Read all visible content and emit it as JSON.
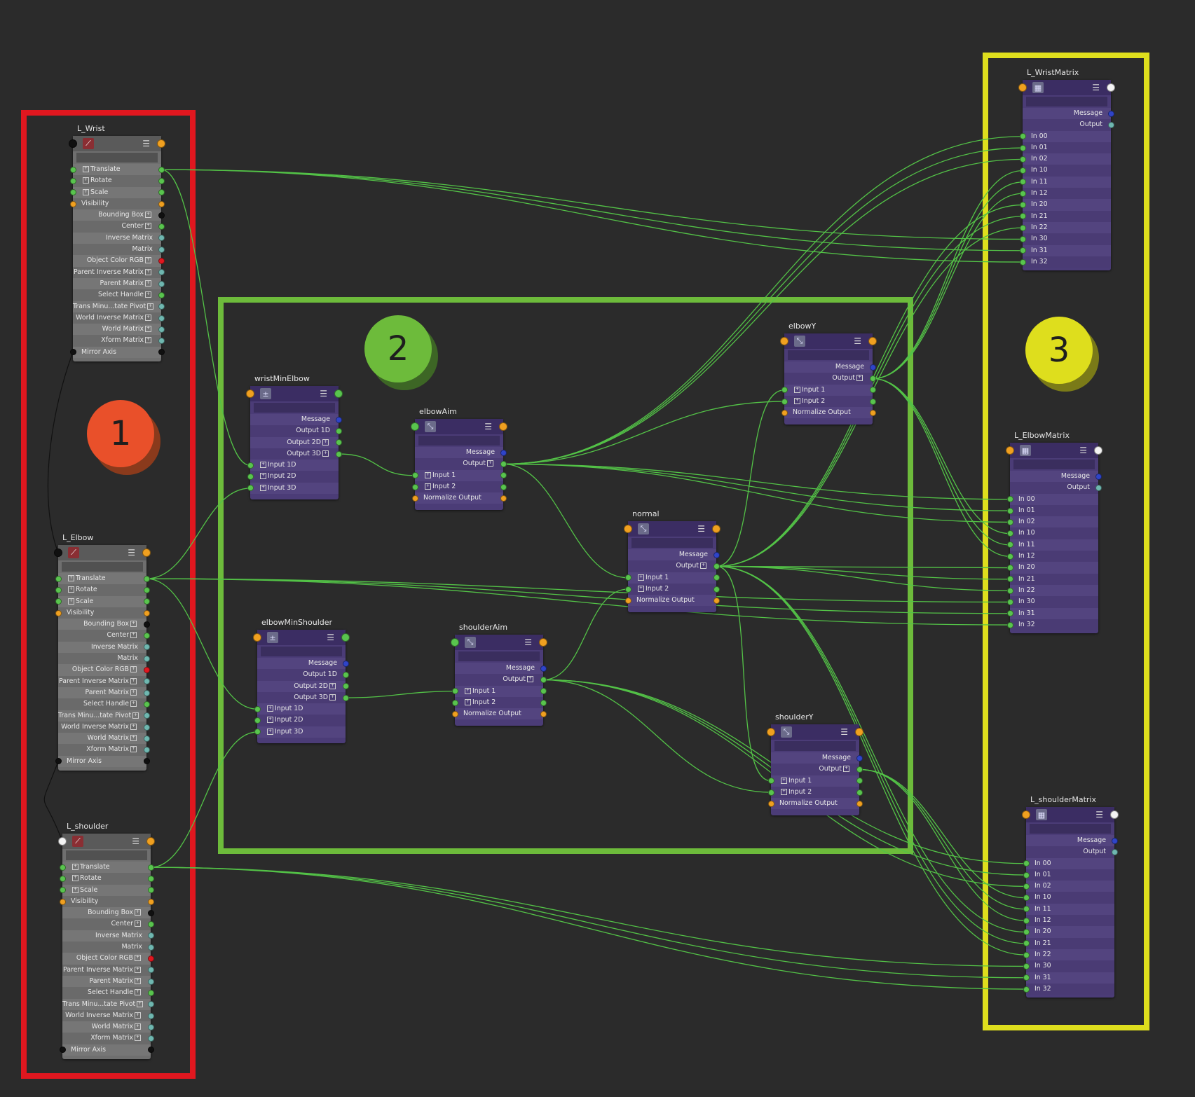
{
  "badges": [
    {
      "label": "1",
      "color": "#e9502a",
      "text_color": "#1e1e1e"
    },
    {
      "label": "2",
      "color": "#6dbb3b",
      "text_color": "#1e1e1e"
    },
    {
      "label": "3",
      "color": "#dede1d",
      "text_color": "#1e1e1e"
    }
  ],
  "frame_colors": {
    "joints": "#e0171f",
    "math": "#6dbb3b",
    "matrices": "#dede1d"
  },
  "port_colors": {
    "green": "#59c44e",
    "orange": "#f0a020",
    "blue": "#2f44c8",
    "teal": "#6fb7b0",
    "black": "#101010",
    "red": "#e0171f",
    "white": "#f4f4f4"
  },
  "wire_color": "#53c247",
  "joints": [
    {
      "name": "L_Wrist",
      "icon": "joint-icon"
    },
    {
      "name": "L_Elbow",
      "icon": "joint-icon"
    },
    {
      "name": "L_shoulder",
      "icon": "joint-icon"
    }
  ],
  "joint_attrs": [
    "Translate",
    "Rotate",
    "Scale",
    "Visibility",
    "Bounding Box",
    "Center",
    "Inverse Matrix",
    "Matrix",
    "Object Color RGB",
    "Parent Inverse Matrix",
    "Parent Matrix",
    "Select Handle",
    "Trans Minu...tate Pivot",
    "World Inverse Matrix",
    "World Matrix",
    "Xform Matrix",
    "Mirror Axis"
  ],
  "math_nodes": [
    {
      "name": "wristMinElbow",
      "icon": "plus-minus-average-icon",
      "rows": [
        "Message",
        "Output 1D",
        "Output 2D",
        "Output 3D",
        "Input 1D",
        "Input 2D",
        "Input 3D"
      ]
    },
    {
      "name": "elbowMinShoulder",
      "icon": "plus-minus-average-icon",
      "rows": [
        "Message",
        "Output 1D",
        "Output 2D",
        "Output 3D",
        "Input 1D",
        "Input 2D",
        "Input 3D"
      ]
    },
    {
      "name": "elbowAim",
      "icon": "vector-product-icon",
      "rows": [
        "Message",
        "Output",
        "Input 1",
        "Input 2",
        "Normalize Output"
      ]
    },
    {
      "name": "shoulderAim",
      "icon": "vector-product-icon",
      "rows": [
        "Message",
        "Output",
        "Input 1",
        "Input 2",
        "Normalize Output"
      ]
    },
    {
      "name": "normal",
      "icon": "vector-product-icon",
      "rows": [
        "Message",
        "Output",
        "Input 1",
        "Input 2",
        "Normalize Output"
      ]
    },
    {
      "name": "elbowY",
      "icon": "vector-product-icon",
      "rows": [
        "Message",
        "Output",
        "Input 1",
        "Input 2",
        "Normalize Output"
      ]
    },
    {
      "name": "shoulderY",
      "icon": "vector-product-icon",
      "rows": [
        "Message",
        "Output",
        "Input 1",
        "Input 2",
        "Normalize Output"
      ]
    }
  ],
  "matrix_nodes": [
    {
      "name": "L_WristMatrix",
      "icon": "four-by-four-matrix-icon"
    },
    {
      "name": "L_ElbowMatrix",
      "icon": "four-by-four-matrix-icon"
    },
    {
      "name": "L_shoulderMatrix",
      "icon": "four-by-four-matrix-icon"
    }
  ],
  "matrix_rows": [
    "Message",
    "Output",
    "In 00",
    "In 01",
    "In 02",
    "In 10",
    "In 11",
    "In 12",
    "In 20",
    "In 21",
    "In 22",
    "In 30",
    "In 31",
    "In 32"
  ],
  "menu_glyph": "☰"
}
